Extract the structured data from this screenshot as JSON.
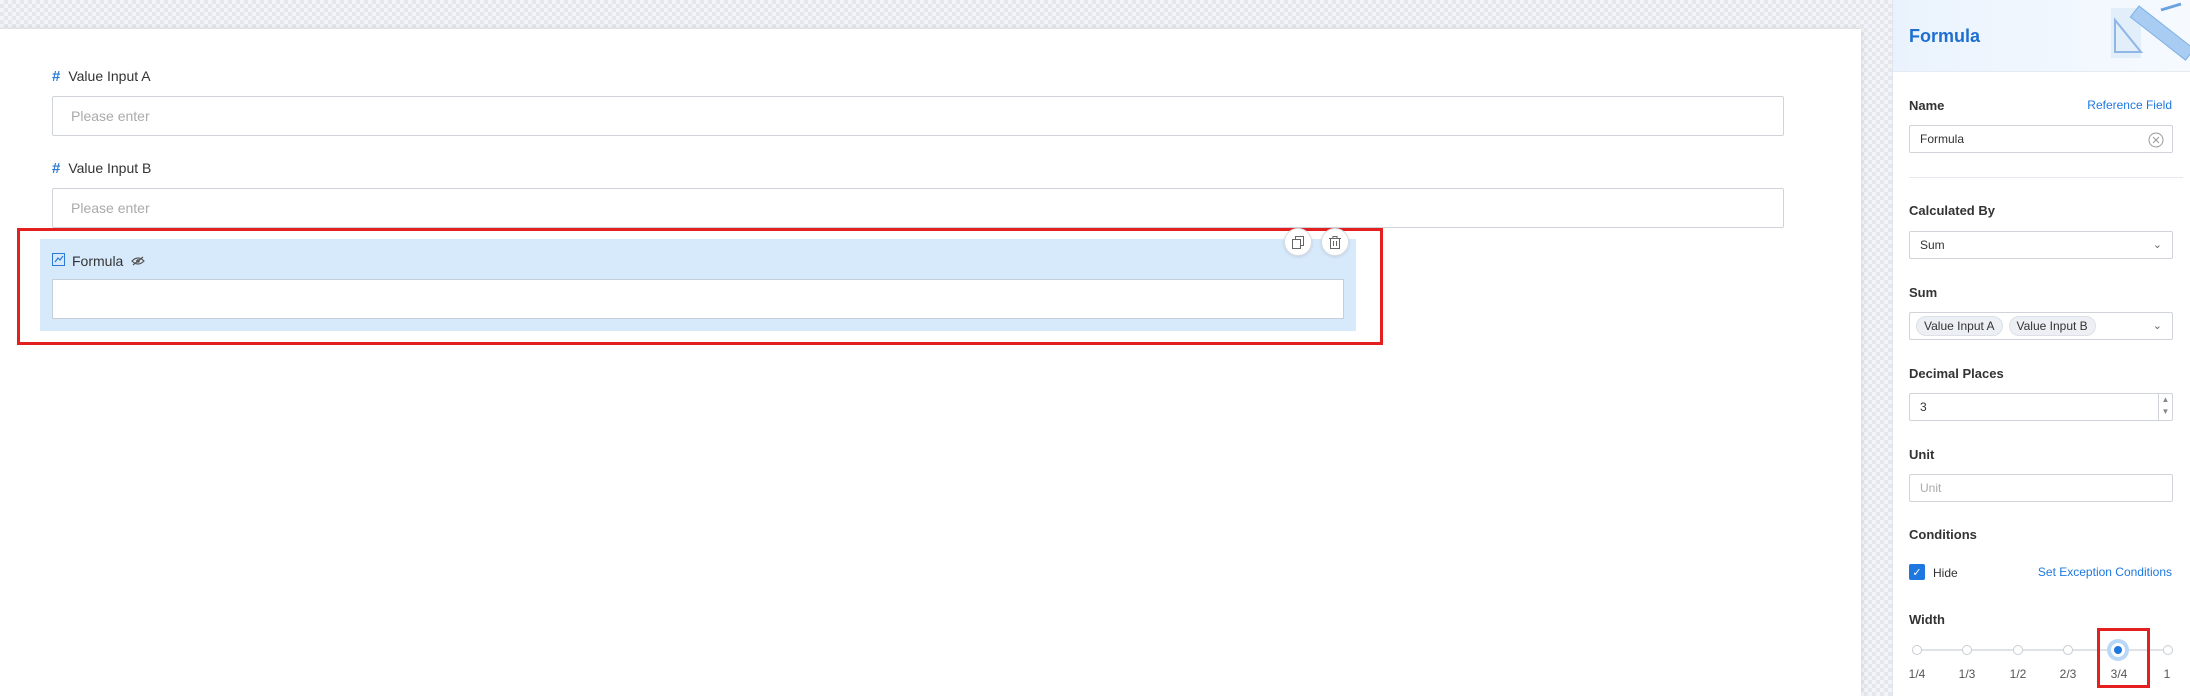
{
  "canvas": {
    "fields": [
      {
        "label": "Value Input A",
        "placeholder": "Please enter",
        "icon": "hash-icon"
      },
      {
        "label": "Value Input B",
        "placeholder": "Please enter",
        "icon": "hash-icon"
      }
    ],
    "formula_field": {
      "label": "Formula",
      "icon": "formula-icon",
      "hidden_icon": "eye-off-icon",
      "value": ""
    },
    "actions": {
      "copy_icon": "copy-icon",
      "delete_icon": "trash-icon"
    }
  },
  "panel": {
    "title": "Formula",
    "name": {
      "label": "Name",
      "link": "Reference Field",
      "value": "Formula"
    },
    "calculated_by": {
      "label": "Calculated By",
      "value": "Sum"
    },
    "sum": {
      "label": "Sum",
      "tags": [
        "Value Input A",
        "Value Input B"
      ]
    },
    "decimal_places": {
      "label": "Decimal Places",
      "value": "3"
    },
    "unit": {
      "label": "Unit",
      "placeholder": "Unit"
    },
    "conditions": {
      "label": "Conditions",
      "checkbox_label": "Hide",
      "checked": true,
      "link": "Set Exception Conditions"
    },
    "width": {
      "label": "Width",
      "options": [
        "1/4",
        "1/3",
        "1/2",
        "2/3",
        "3/4",
        "1"
      ],
      "selected": "3/4"
    }
  },
  "colors": {
    "accent": "#1e78e0",
    "highlight": "#e41f1f",
    "selected_bg": "#d7eafc"
  }
}
